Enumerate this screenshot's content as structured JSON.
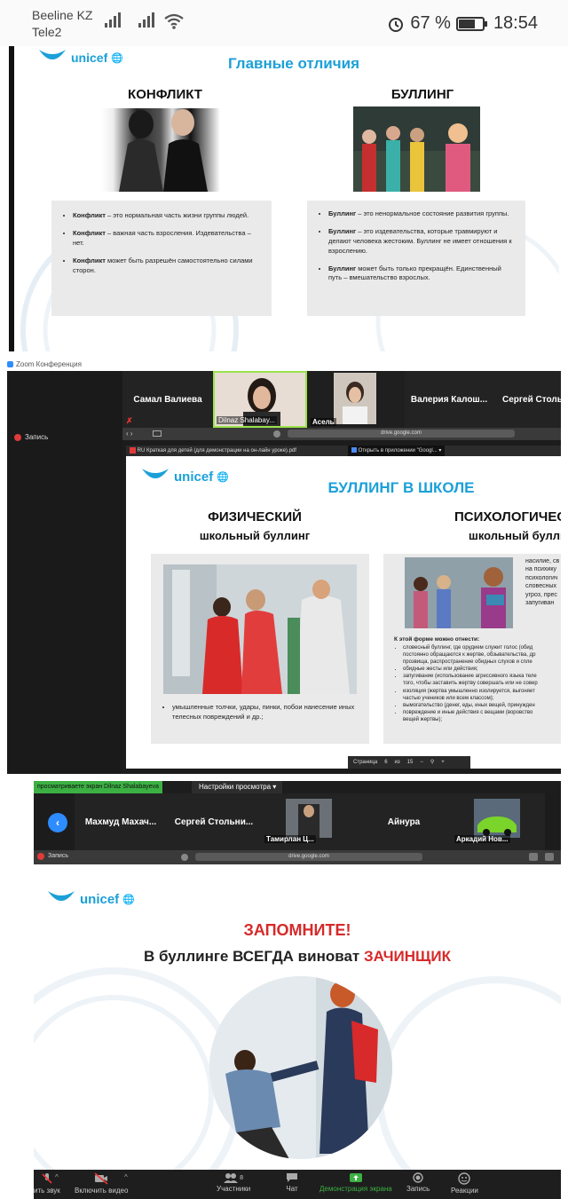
{
  "status_bar": {
    "carrier_1": "Beeline KZ",
    "carrier_2": "Tele2",
    "battery": "67 %",
    "time": "18:54"
  },
  "slide_1": {
    "logo_text": "unicef",
    "title": "Главные отличия",
    "left_heading": "КОНФЛИКТ",
    "right_heading": "БУЛЛИНГ",
    "left_bullets": [
      {
        "bold": "Конфликт",
        "text": " – это нормальная часть жизни группы людей."
      },
      {
        "bold": "Конфликт",
        "text": " – важная часть взросления. Издевательства – нет."
      },
      {
        "bold": "Конфликт",
        "text": " может быть разрешён самостоятельно силами сторон."
      }
    ],
    "right_bullets": [
      {
        "bold": "Буллинг",
        "text": " – это ненормальное состояние развития группы."
      },
      {
        "bold": "Буллинг",
        "text": " – это издевательства, которые травмируют и делают человека жестоким. Буллинг не имеет отношения к взрослению."
      },
      {
        "bold": "Буллинг",
        "text": " может быть только прекращён. Единственный путь – вмешательство взрослых."
      }
    ]
  },
  "zoom_window": {
    "title": "Zoom Конференция",
    "record_label": "Запись",
    "participants": [
      "Самал Валиева",
      "Dilnaz Shalabay...",
      "Асель",
      "Валерия Калош...",
      "Сергей Столь..."
    ],
    "url": "drive.google.com",
    "pdf_tab": "RU Краткая для детей (для демонстрации на он-лайн уроке).pdf",
    "open_in_app": "Открыть в приложении \"Googl...",
    "page_label": "Страница",
    "page_number": "6",
    "page_of": "из",
    "page_total": "15"
  },
  "slide_2": {
    "logo_text": "unicef",
    "title": "БУЛЛИНГ В ШКОЛЕ",
    "left_heading_1": "ФИЗИЧЕСКИЙ",
    "left_heading_2": "школьный буллинг",
    "right_heading_1": "ПСИХОЛОГИЧЕСК",
    "right_heading_2": "школьный булли",
    "left_bullet": "умышленные толчки, удары, пинки, побои нанесение иных телесных повреждений и др.;",
    "right_side_bullets": [
      "насилие, св",
      "на психику",
      "психологич",
      "словесных",
      "угроз, прес",
      "запугиван"
    ],
    "right_subhead": "К этой форме можно отнести:",
    "right_list": [
      "словесный буллинг, где орудием служит голос (обид",
      "постоянно обращаются к жертве, обзывательства, др",
      "прозвища, распространение обидных слухов и спле",
      "обидные жесты или действия;",
      "запугивание (использование агрессивного языка теле",
      "того, чтобы заставить жертву совершать или не совер",
      "изоляция (жертва умышленно изолируется, выгоняет",
      "частью учеников или всем классом);",
      "вымогательство (денег, еды, иных вещей, принужден",
      "повреждение и иные действия с вещами (воровство",
      "вещей жертвы);"
    ]
  },
  "zoom_window_2": {
    "viewing_banner": "просматриваете экран Dilnaz Shalabayeva",
    "view_settings": "Настройки просмотра",
    "participants": [
      "Махмуд Махач...",
      "Сергей Стольни...",
      "Тамирлан Ц...",
      "Айнура",
      "Аркадий Нов..."
    ],
    "record_label": "Запись",
    "url": "drive.google.com"
  },
  "slide_3": {
    "logo_text": "unicef",
    "title_red": "ЗАПОМНИТЕ!",
    "subtitle_black": "В буллинге ВСЕГДА виноват ",
    "subtitle_red": "ЗАЧИНЩИК"
  },
  "toolbar": {
    "items": [
      {
        "label": "ить звук",
        "icon": "mic-muted-icon"
      },
      {
        "label": "Включить видео",
        "icon": "video-off-icon"
      },
      {
        "label": "Участники",
        "icon": "participants-icon",
        "count": "8"
      },
      {
        "label": "Чат",
        "icon": "chat-icon"
      },
      {
        "label": "Демонстрация экрана",
        "icon": "share-screen-icon"
      },
      {
        "label": "Запись",
        "icon": "record-icon"
      },
      {
        "label": "Реакции",
        "icon": "reactions-icon"
      }
    ]
  },
  "colors": {
    "unicef_blue": "#1ba0d8",
    "zoom_dark": "#1c1c1c",
    "zoom_green": "#3cb043",
    "alert_red": "#d62a2a"
  }
}
